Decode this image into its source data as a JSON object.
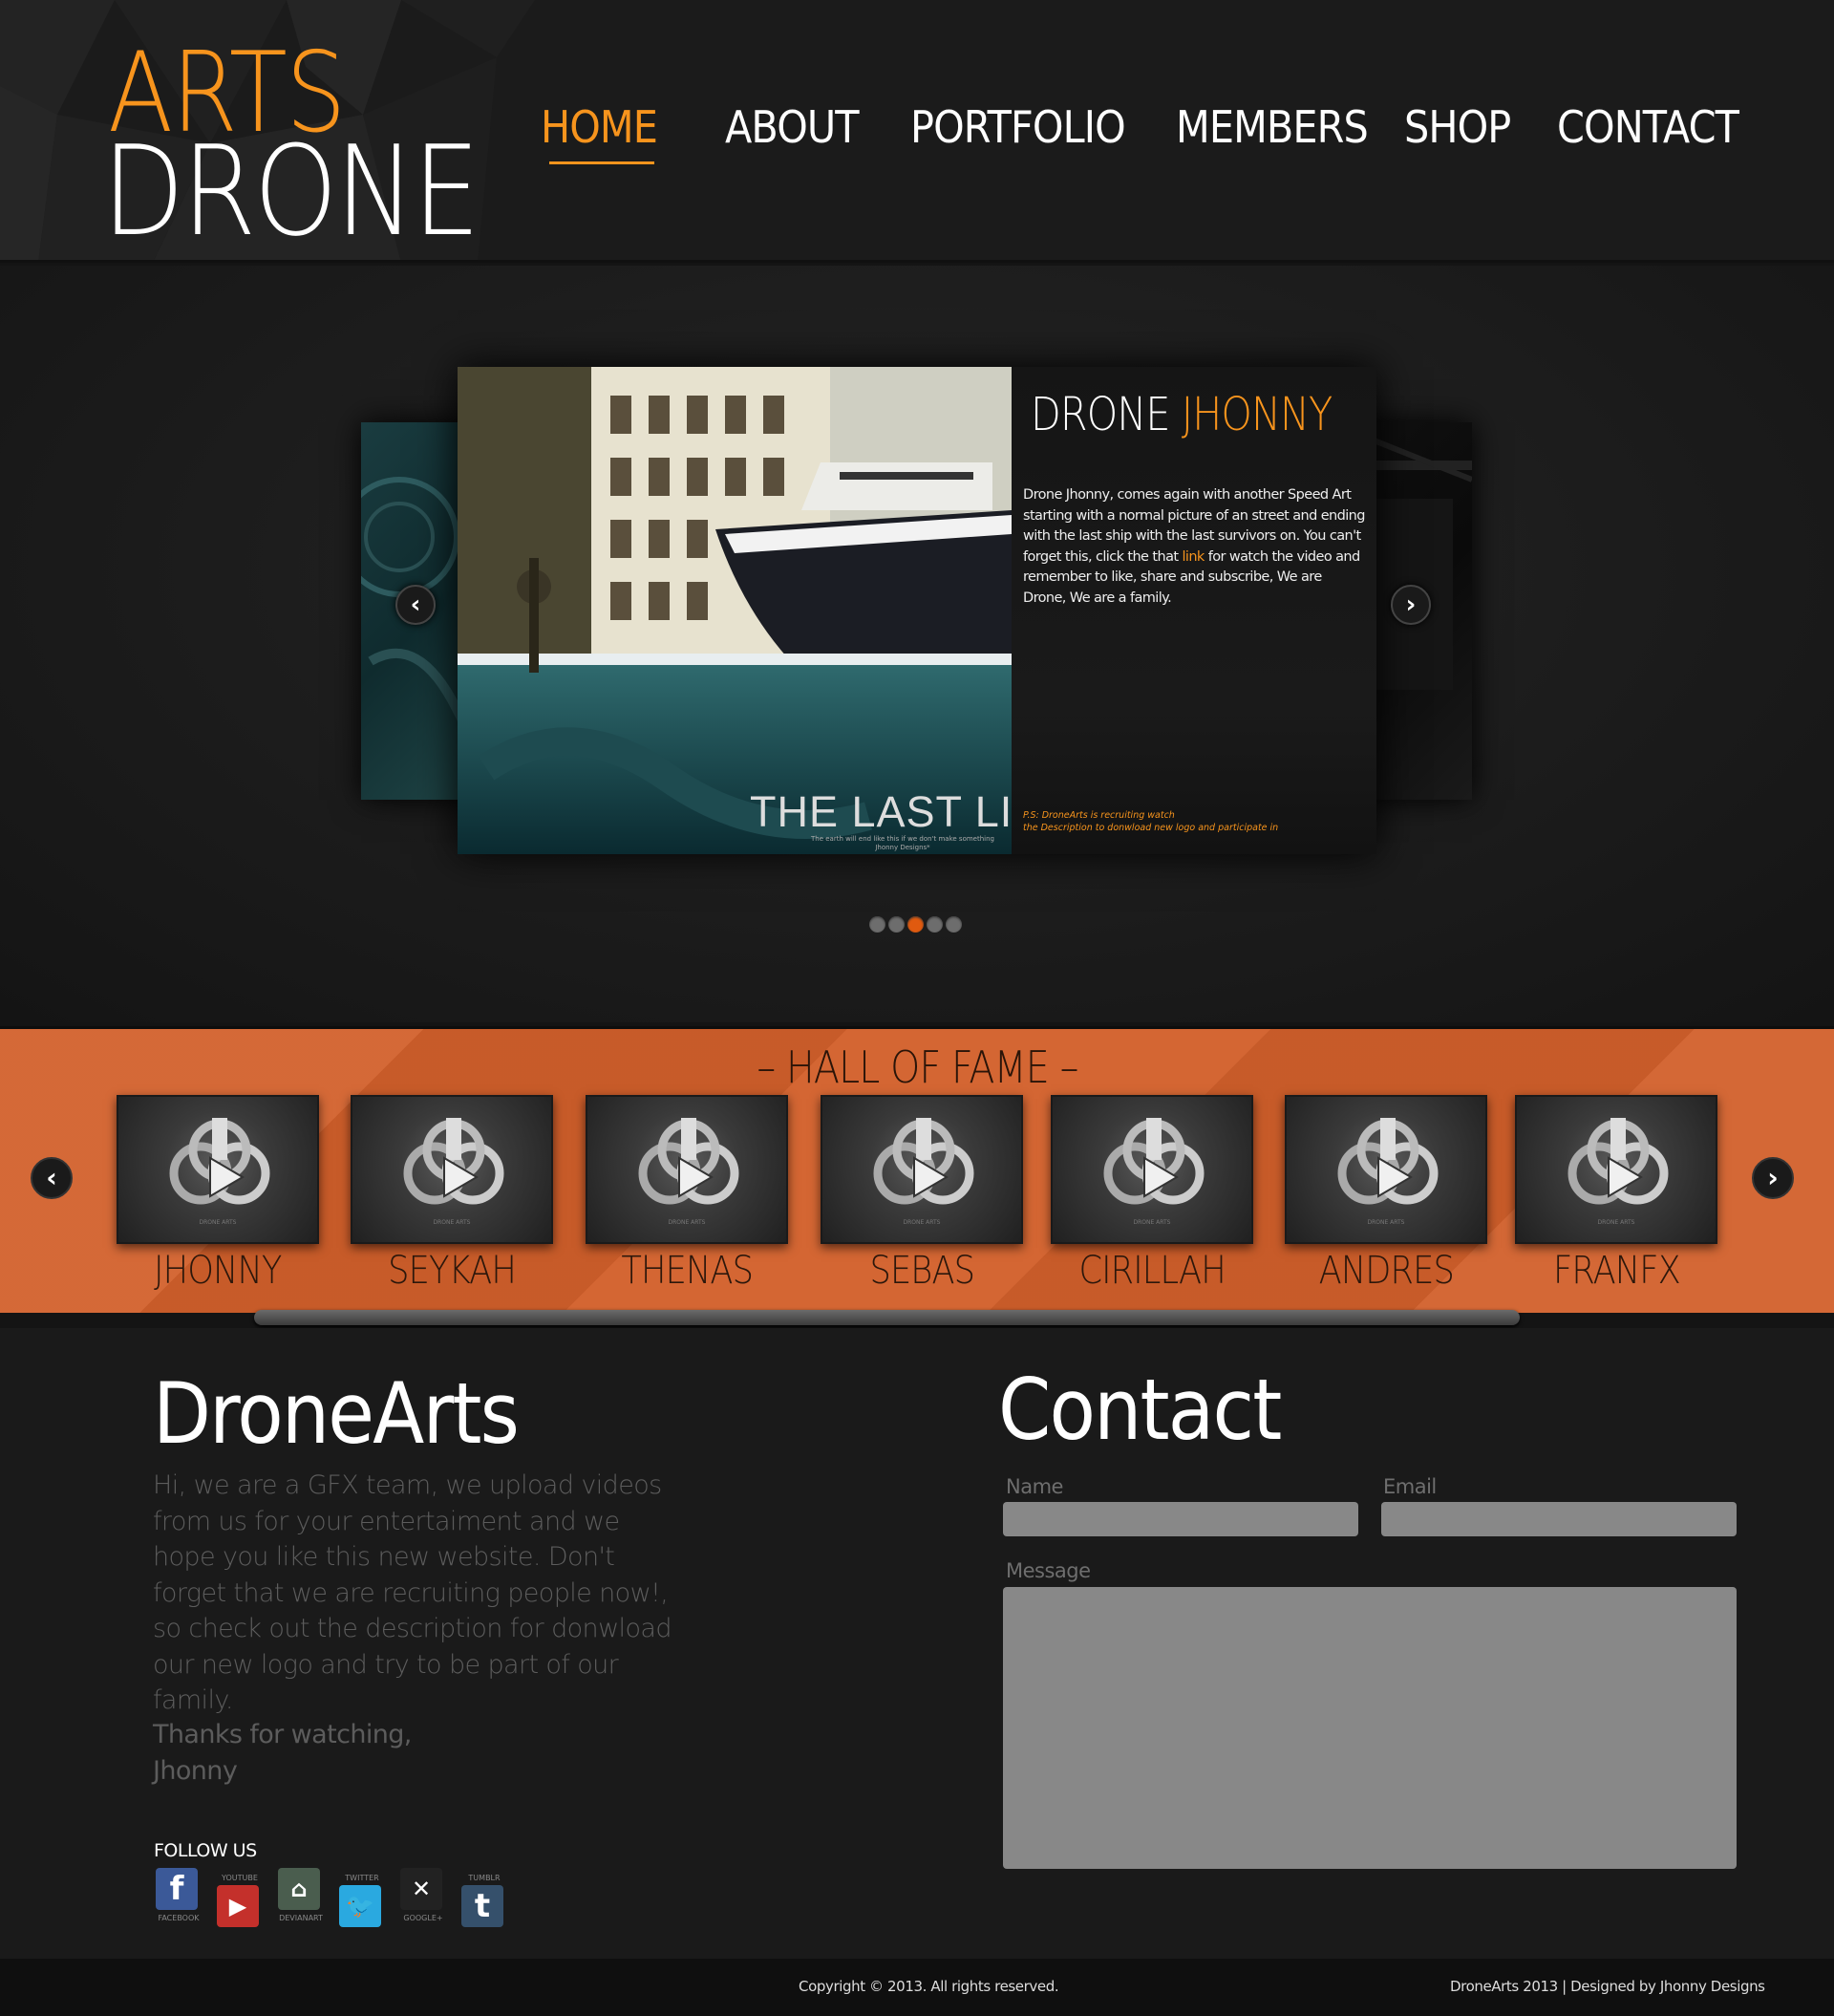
{
  "header": {
    "logo_top": "ARTS",
    "logo_bottom": "DRONE",
    "nav": [
      {
        "label": "HOME",
        "active": true
      },
      {
        "label": "ABOUT"
      },
      {
        "label": "PORTFOLIO"
      },
      {
        "label": "MEMBERS"
      },
      {
        "label": "SHOP"
      },
      {
        "label": "CONTACT"
      }
    ]
  },
  "slider": {
    "title_white": "DRONE",
    "title_orange": "JHONNY",
    "body_before_link": "Drone Jhonny, comes again with another Speed Art starting with a normal picture of an street and ending with the last ship with the last survivors on. You can't forget this, click the that",
    "link_text": "link",
    "body_after_link": "for watch the video and remember to like, share and subscribe, We are Drone, We are a family.",
    "ps_line1": "P.S: DroneArts is recruiting watch",
    "ps_line2": "the Description to donwload new logo and participate in",
    "image_caption": "THE LAST LI",
    "image_subcaption_1": "The earth will end like this if we don't make something",
    "image_subcaption_2": "Jhonny Designs*",
    "prev_icon": "chevron-left-icon",
    "next_icon": "chevron-right-icon",
    "dots_count": 5,
    "active_dot": 3
  },
  "hall_of_fame": {
    "title": "– HALL OF FAME –",
    "members": [
      "JHONNY",
      "SEYKAH",
      "THENAS",
      "SEBAS",
      "CIRILLAH",
      "ANDRES",
      "FRANFX"
    ],
    "thumb_icon": "drone-arts-logo-play-icon",
    "thumb_caption": "DRONE ARTS"
  },
  "about": {
    "title": "DroneArts",
    "text": "Hi, we are a GFX team, we upload videos from us for your entertaiment and we hope you like this new website. Don't forget that we are recruiting people now!, so check out the description for donwload our new logo and try to be part of our family.",
    "sign_line1": "Thanks for watching,",
    "sign_line2": "Jhonny",
    "follow_title": "FOLLOW US",
    "social": [
      {
        "label": "FACEBOOK",
        "icon": "facebook-icon",
        "glyph": "f",
        "color": "#3b5998"
      },
      {
        "label": "YOUTUBE",
        "icon": "youtube-icon",
        "glyph": "▶",
        "color": "#c4302b"
      },
      {
        "label": "DEVIANART",
        "icon": "deviantart-icon",
        "glyph": "⌂",
        "color": "#4a5d4e"
      },
      {
        "label": "TWITTER",
        "icon": "twitter-icon",
        "glyph": "🐦",
        "color": "#2aa9e0"
      },
      {
        "label": "GOOGLE+",
        "icon": "google-plus-icon",
        "glyph": "✕",
        "color": "#222222"
      },
      {
        "label": "TUMBLR",
        "icon": "tumblr-icon",
        "glyph": "t",
        "color": "#35506b"
      }
    ]
  },
  "contact": {
    "title": "Contact",
    "name_label": "Name",
    "email_label": "Email",
    "message_label": "Message"
  },
  "footer": {
    "copyright": "Copyright © 2013. All rights reserved.",
    "credits": "DroneArts 2013 | Designed by Jhonny Designs"
  },
  "colors": {
    "accent": "#f7941d",
    "hall_bg": "#d2602b",
    "dot_active": "#e05a0f"
  }
}
